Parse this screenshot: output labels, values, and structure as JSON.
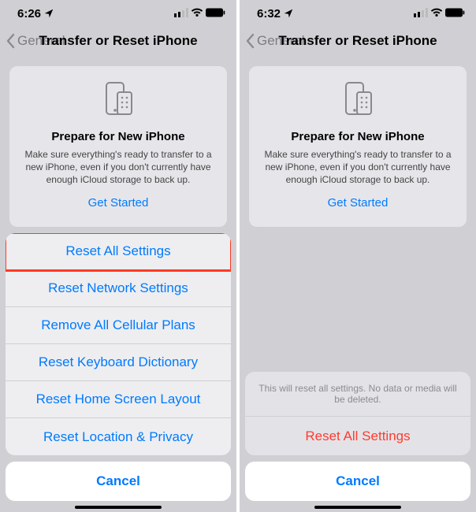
{
  "left": {
    "status": {
      "time": "6:26"
    },
    "nav": {
      "back": "General",
      "title": "Transfer or Reset iPhone"
    },
    "card": {
      "title": "Prepare for New iPhone",
      "desc": "Make sure everything's ready to transfer to a new iPhone, even if you don't currently have enough iCloud storage to back up.",
      "cta": "Get Started"
    },
    "sheet": {
      "items": [
        "Reset All Settings",
        "Reset Network Settings",
        "Remove All Cellular Plans",
        "Reset Keyboard Dictionary",
        "Reset Home Screen Layout",
        "Reset Location & Privacy"
      ],
      "cancel": "Cancel"
    }
  },
  "right": {
    "status": {
      "time": "6:32"
    },
    "nav": {
      "back": "General",
      "title": "Transfer or Reset iPhone"
    },
    "card": {
      "title": "Prepare for New iPhone",
      "desc": "Make sure everything's ready to transfer to a new iPhone, even if you don't currently have enough iCloud storage to back up.",
      "cta": "Get Started"
    },
    "confirm": {
      "message": "This will reset all settings. No data or media will be deleted.",
      "action": "Reset All Settings",
      "cancel": "Cancel"
    }
  }
}
